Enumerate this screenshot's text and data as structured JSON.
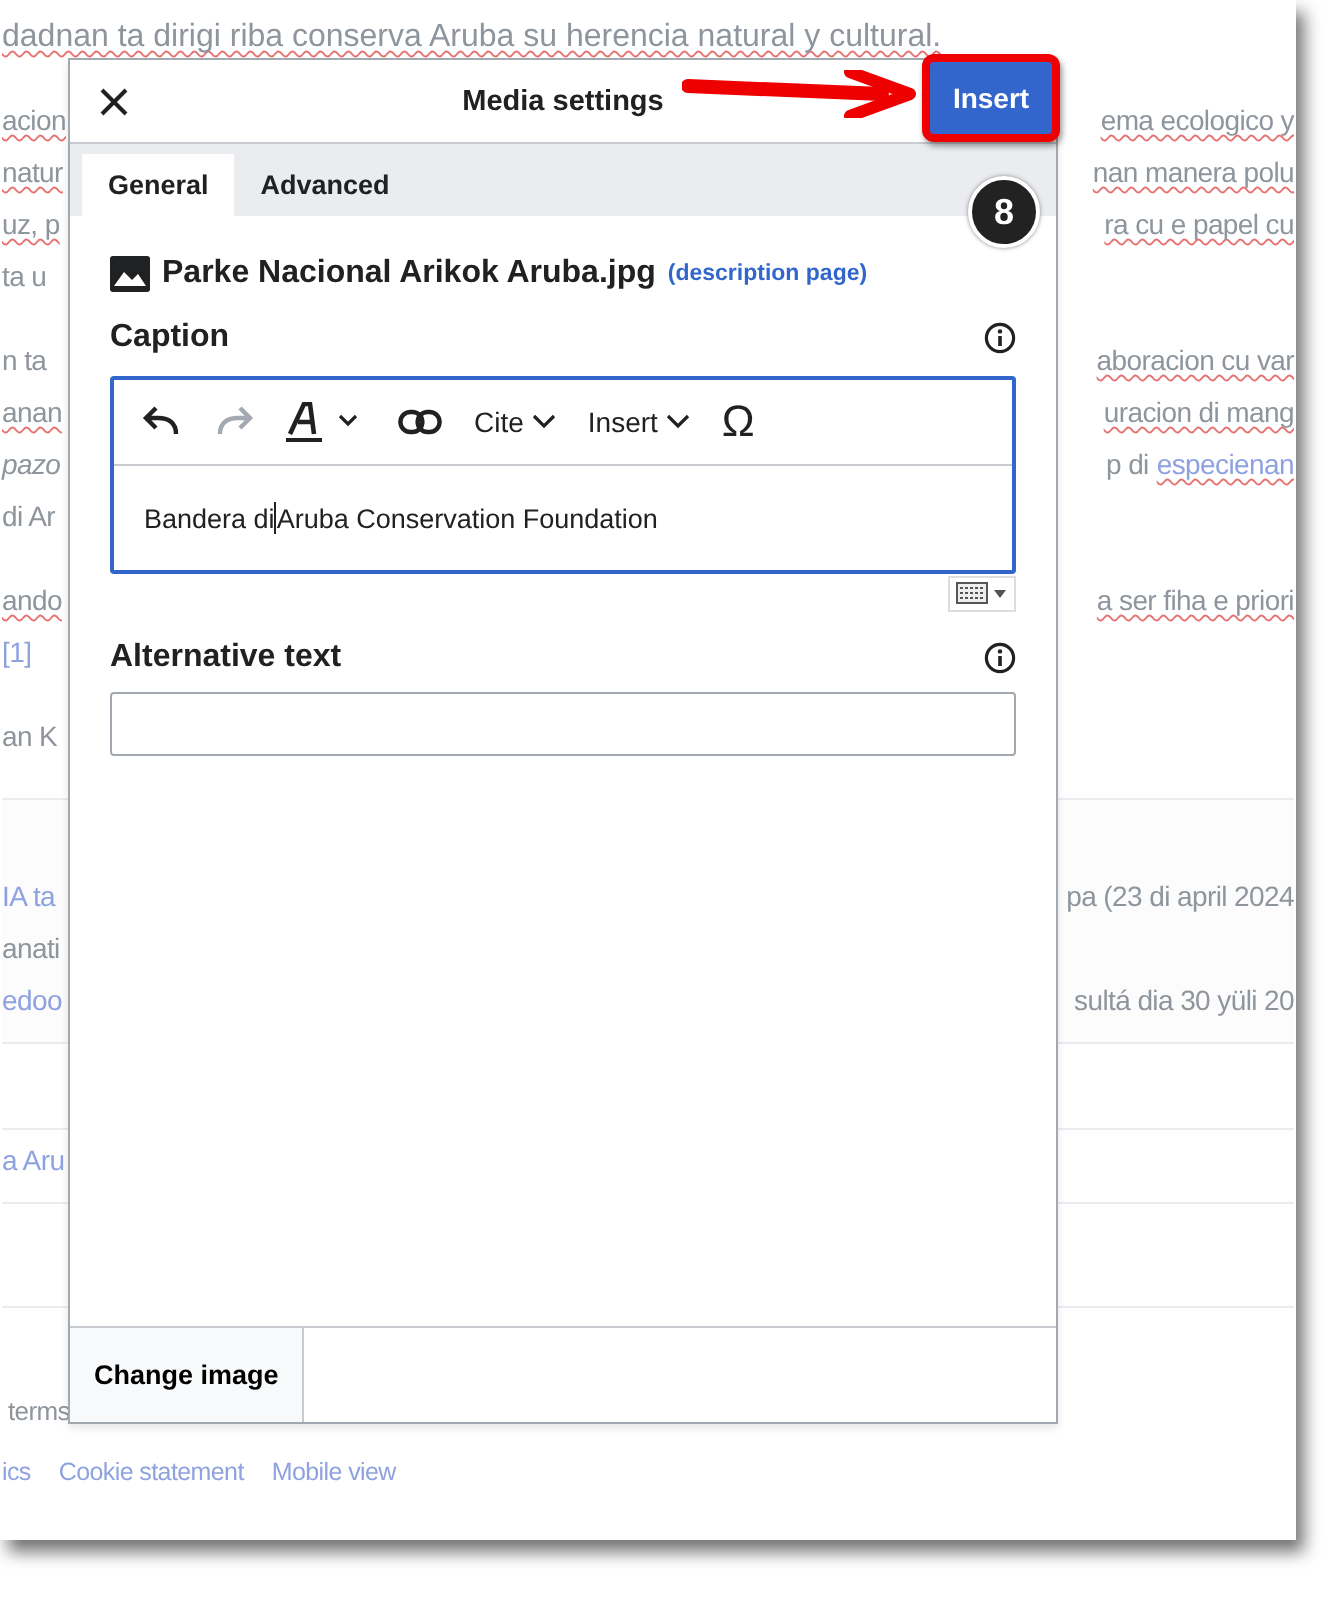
{
  "background": {
    "paragraphs": [
      [
        {
          "left": [
            {
              "text": "dadnan ta dirigi riba conserva Aruba su herencia natural y cultural.",
              "kind": "text",
              "misspelled": true
            }
          ]
        }
      ],
      [
        {
          "left": [
            {
              "text": "acion",
              "kind": "text",
              "misspelled": true
            }
          ],
          "right": [
            {
              "text": "ema ecologico y",
              "kind": "text",
              "misspelled": true
            }
          ]
        },
        {
          "left": [
            {
              "text": "natur",
              "kind": "text",
              "misspelled": true
            }
          ],
          "right": [
            {
              "text": "nan manera polu",
              "kind": "text",
              "misspelled": true
            }
          ]
        },
        {
          "left": [
            {
              "text": "uz, p",
              "kind": "text",
              "misspelled": true
            }
          ],
          "right": [
            {
              "text": "ra cu e papel cu",
              "kind": "text",
              "misspelled": true
            }
          ]
        },
        {
          "left": [
            {
              "text": "ta u",
              "kind": "text",
              "misspelled": false
            }
          ]
        }
      ],
      [
        {
          "left": [
            {
              "text": "n ta",
              "kind": "text",
              "misspelled": false
            }
          ],
          "right": [
            {
              "text": "aboracion cu var",
              "kind": "text",
              "misspelled": true
            }
          ]
        },
        {
          "left": [
            {
              "text": "anan",
              "kind": "text",
              "misspelled": true
            }
          ],
          "right": [
            {
              "text": "uracion di mang",
              "kind": "text",
              "misspelled": true
            }
          ]
        },
        {
          "left": [
            {
              "text": "pazo",
              "kind": "italic",
              "misspelled": false
            }
          ],
          "right": [
            {
              "text": "p di",
              "kind": "text",
              "misspelled": false
            },
            {
              "text": "especienan",
              "kind": "link",
              "misspelled": true
            }
          ]
        },
        {
          "left": [
            {
              "text": "di Ar",
              "kind": "text",
              "misspelled": false
            }
          ]
        }
      ],
      [
        {
          "left": [
            {
              "text": "ando",
              "kind": "text",
              "misspelled": true
            }
          ],
          "right": [
            {
              "text": "a ser fiha e priori",
              "kind": "text",
              "misspelled": true
            }
          ]
        },
        {
          "left": [
            {
              "text": "[1]",
              "kind": "link",
              "misspelled": false
            }
          ]
        }
      ],
      [
        {
          "left": [
            {
              "text": "an K",
              "kind": "text",
              "misspelled": false
            }
          ]
        }
      ]
    ],
    "references_box": [
      {
        "left": [
          {
            "text": "IA ta",
            "kind": "link",
            "misspelled": false
          }
        ],
        "right": [
          {
            "text": "pa (23 di april 2024",
            "kind": "text",
            "misspelled": false
          }
        ]
      },
      {
        "left": [
          {
            "text": "anati",
            "kind": "text",
            "misspelled": false
          }
        ]
      },
      {
        "left": [
          {
            "text": "edoo",
            "kind": "link",
            "misspelled": false
          }
        ],
        "right": [
          {
            "text": "sultá dia 30 yüli 20",
            "kind": "text",
            "misspelled": false
          }
        ]
      }
    ],
    "nav_box": [
      {
        "left": [
          {
            "text": "a Aru",
            "kind": "link",
            "misspelled": false
          }
        ]
      }
    ],
    "footer": {
      "license": "terms",
      "links": [
        "ics",
        "Cookie statement",
        "Mobile view"
      ]
    }
  },
  "dialog": {
    "title": "Media settings",
    "primary_button": "Insert",
    "step_badge": "8",
    "tabs": [
      {
        "label": "General",
        "selected": true
      },
      {
        "label": "Advanced",
        "selected": false
      }
    ],
    "file": {
      "name": "Parke Nacional Arikok Aruba.jpg",
      "link": "(description page)"
    },
    "caption": {
      "label": "Caption",
      "toolbar": [
        {
          "kind": "undo",
          "disabled": false
        },
        {
          "kind": "redo",
          "disabled": true
        },
        {
          "kind": "style",
          "disabled": false
        },
        {
          "kind": "link",
          "disabled": false
        },
        {
          "kind": "menu",
          "label": "Cite",
          "disabled": false
        },
        {
          "kind": "menu",
          "label": "Insert",
          "disabled": false
        },
        {
          "kind": "special",
          "label": "Ω",
          "disabled": false
        }
      ],
      "value_before_cursor": "Bandera di",
      "value_after_cursor": "Aruba Conservation Foundation"
    },
    "alt_text": {
      "label": "Alternative text"
    },
    "footer_button": "Change image"
  }
}
